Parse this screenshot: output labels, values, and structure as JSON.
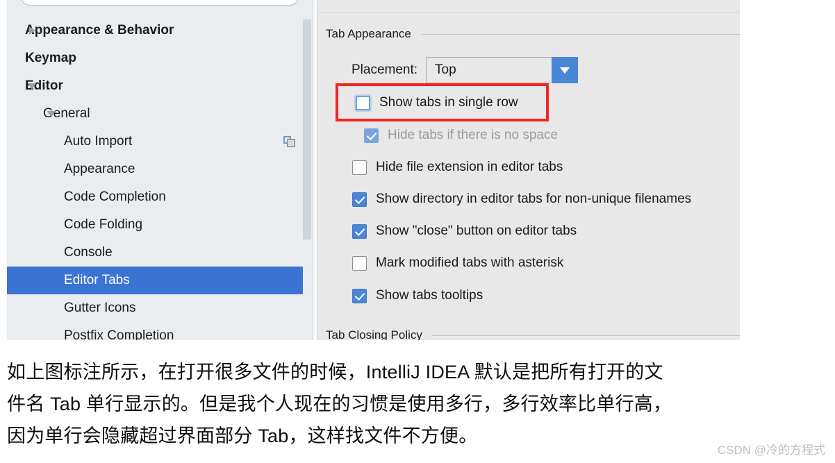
{
  "dialog": {
    "sidebar": {
      "search_placeholder": "",
      "items": [
        {
          "label": "Appearance & Behavior",
          "level": 0,
          "bold": true,
          "arrow": "right",
          "selected": false,
          "trailing_icon": ""
        },
        {
          "label": "Keymap",
          "level": 0,
          "bold": true,
          "arrow": "none",
          "selected": false,
          "trailing_icon": ""
        },
        {
          "label": "Editor",
          "level": 0,
          "bold": true,
          "arrow": "down",
          "selected": false,
          "trailing_icon": ""
        },
        {
          "label": "General",
          "level": 1,
          "bold": false,
          "arrow": "down1",
          "selected": false,
          "trailing_icon": ""
        },
        {
          "label": "Auto Import",
          "level": 2,
          "bold": false,
          "arrow": "none",
          "selected": false,
          "trailing_icon": "copy-icon"
        },
        {
          "label": "Appearance",
          "level": 2,
          "bold": false,
          "arrow": "none",
          "selected": false,
          "trailing_icon": ""
        },
        {
          "label": "Code Completion",
          "level": 2,
          "bold": false,
          "arrow": "none",
          "selected": false,
          "trailing_icon": ""
        },
        {
          "label": "Code Folding",
          "level": 2,
          "bold": false,
          "arrow": "none",
          "selected": false,
          "trailing_icon": ""
        },
        {
          "label": "Console",
          "level": 2,
          "bold": false,
          "arrow": "none",
          "selected": false,
          "trailing_icon": ""
        },
        {
          "label": "Editor Tabs",
          "level": 2,
          "bold": false,
          "arrow": "none",
          "selected": true,
          "trailing_icon": ""
        },
        {
          "label": "Gutter Icons",
          "level": 2,
          "bold": false,
          "arrow": "none",
          "selected": false,
          "trailing_icon": ""
        },
        {
          "label": "Postfix Completion",
          "level": 2,
          "bold": false,
          "arrow": "none",
          "selected": false,
          "trailing_icon": ""
        }
      ],
      "selection_color": "#3c74d4"
    },
    "settings": {
      "group_title": "Tab Appearance",
      "next_group_title": "Tab Closing Policy",
      "placement": {
        "label": "Placement:",
        "value": "Top"
      },
      "options": [
        {
          "label": "Show tabs in single row",
          "checked": false,
          "enabled": true,
          "focused": true,
          "indent": 0
        },
        {
          "label": "Hide tabs if there is no space",
          "checked": true,
          "enabled": false,
          "focused": false,
          "indent": 1
        },
        {
          "label": "Hide file extension in editor tabs",
          "checked": false,
          "enabled": true,
          "focused": false,
          "indent": 0
        },
        {
          "label": "Show directory in editor tabs for non-unique filenames",
          "checked": true,
          "enabled": true,
          "focused": false,
          "indent": 0
        },
        {
          "label": "Show \"close\" button on editor tabs",
          "checked": true,
          "enabled": true,
          "focused": false,
          "indent": 0
        },
        {
          "label": "Mark modified tabs with asterisk",
          "checked": false,
          "enabled": true,
          "focused": false,
          "indent": 0
        },
        {
          "label": "Show tabs tooltips",
          "checked": true,
          "enabled": true,
          "focused": false,
          "indent": 0
        }
      ],
      "accent_color": "#4a86d8",
      "background_color": "#e8e8e8"
    },
    "annotation": {
      "color": "#f42525",
      "target_label": "Show tabs in single row"
    }
  },
  "caption": {
    "line1": "如上图标注所示，在打开很多文件的时候，IntelliJ IDEA 默认是把所有打开的文",
    "line2": "件名 Tab 单行显示的。但是我个人现在的习惯是使用多行，多行效率比单行高，",
    "line3": "因为单行会隐藏超过界面部分 Tab，这样找文件不方便。"
  },
  "watermark": {
    "text": "CSDN @冷的方程式"
  }
}
